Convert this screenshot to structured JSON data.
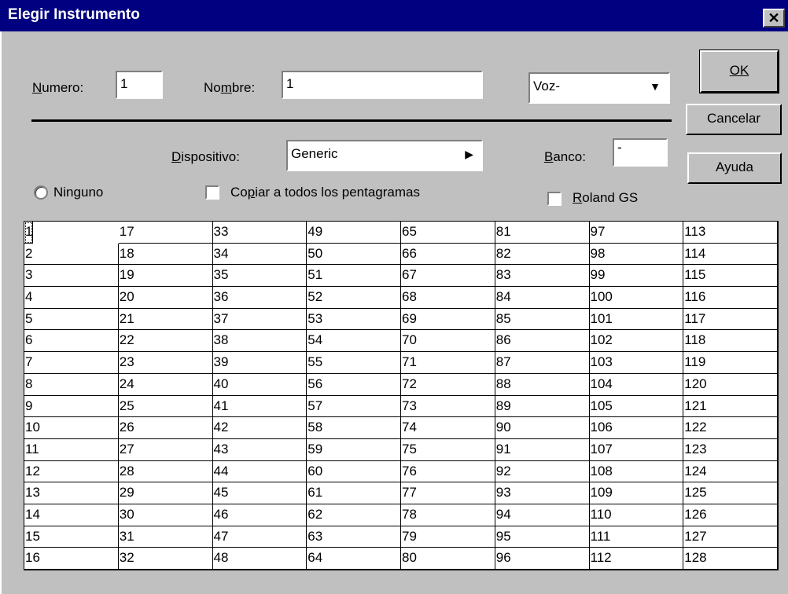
{
  "window": {
    "title": "Elegir Instrumento",
    "close_label": "✕"
  },
  "numero": {
    "label": "Numero:",
    "value": "1"
  },
  "nombre": {
    "label": "Nombre:",
    "value": "1"
  },
  "voz": {
    "value": "Voz-"
  },
  "dispositivo": {
    "label": "Dispositivo:",
    "value": "Generic"
  },
  "banco": {
    "label": "Banco:",
    "value": "-"
  },
  "ninguno": {
    "label": "Ninguno"
  },
  "copiar": {
    "label": "Copiar a todos los pentagramas"
  },
  "roland": {
    "label": "Roland GS"
  },
  "buttons": {
    "ok": "OK",
    "cancelar": "Cancelar",
    "ayuda": "Ayuda"
  },
  "grid": {
    "cells": [
      "1",
      "2",
      "3",
      "4",
      "5",
      "6",
      "7",
      "8",
      "9",
      "10",
      "11",
      "12",
      "13",
      "14",
      "15",
      "16",
      "17",
      "18",
      "19",
      "20",
      "21",
      "22",
      "23",
      "24",
      "25",
      "26",
      "27",
      "28",
      "29",
      "30",
      "31",
      "32",
      "33",
      "34",
      "35",
      "36",
      "37",
      "38",
      "39",
      "40",
      "41",
      "42",
      "43",
      "44",
      "45",
      "46",
      "47",
      "48",
      "49",
      "50",
      "51",
      "52",
      "53",
      "54",
      "55",
      "56",
      "57",
      "58",
      "59",
      "60",
      "61",
      "62",
      "63",
      "64",
      "65",
      "66",
      "67",
      "68",
      "69",
      "70",
      "71",
      "72",
      "73",
      "74",
      "75",
      "76",
      "77",
      "78",
      "79",
      "80",
      "81",
      "82",
      "83",
      "84",
      "85",
      "86",
      "87",
      "88",
      "89",
      "90",
      "91",
      "92",
      "93",
      "94",
      "95",
      "96",
      "97",
      "98",
      "99",
      "100",
      "101",
      "102",
      "103",
      "104",
      "105",
      "106",
      "107",
      "108",
      "109",
      "110",
      "111",
      "112",
      "113",
      "114",
      "115",
      "116",
      "117",
      "118",
      "119",
      "120",
      "121",
      "122",
      "123",
      "124",
      "125",
      "126",
      "127",
      "128"
    ]
  }
}
